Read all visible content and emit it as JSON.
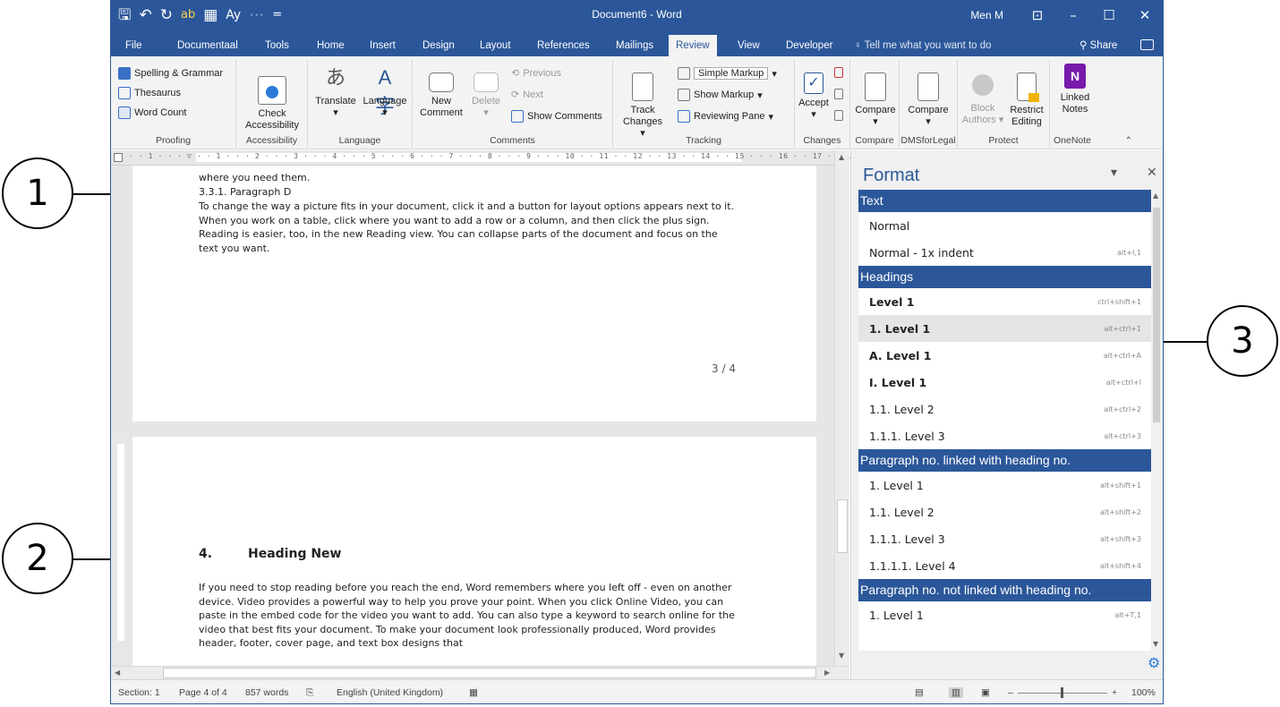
{
  "window": {
    "title": "Document6 - Word",
    "user": "Men M",
    "qat": [
      "🖫",
      "↶",
      "↻",
      "ab",
      "▦",
      "Ay",
      "⋯",
      "="
    ],
    "controls": [
      "⊡",
      "–",
      "☐",
      "✕"
    ]
  },
  "tabs": [
    "File",
    "Documentaal",
    "Tools",
    "Home",
    "Insert",
    "Design",
    "Layout",
    "References",
    "Mailings",
    "Review",
    "View",
    "Developer"
  ],
  "active_tab": "Review",
  "tell_me": "Tell me what you want to do",
  "share": "Share",
  "ribbon": {
    "proofing": {
      "spelling": "Spelling & Grammar",
      "thesaurus": "Thesaurus",
      "word_count": "Word Count",
      "label": "Proofing"
    },
    "accessibility": {
      "check1": "Check",
      "check2": "Accessibility",
      "label": "Accessibility"
    },
    "language": {
      "translate": "Translate",
      "language": "Language",
      "label": "Language"
    },
    "comments": {
      "new1": "New",
      "new2": "Comment",
      "delete": "Delete",
      "previous": "Previous",
      "next": "Next",
      "show": "Show Comments",
      "label": "Comments"
    },
    "tracking": {
      "track1": "Track",
      "track2": "Changes",
      "markup": "Simple Markup",
      "show_markup": "Show Markup",
      "reviewing": "Reviewing Pane",
      "label": "Tracking"
    },
    "changes": {
      "accept": "Accept",
      "label": "Changes"
    },
    "compare": {
      "btn": "Compare",
      "label": "Compare"
    },
    "dms": {
      "btn": "Compare",
      "label": "DMSforLegal"
    },
    "protect": {
      "block1": "Block",
      "block2": "Authors",
      "restrict1": "Restrict",
      "restrict2": "Editing",
      "label": "Protect"
    },
    "onenote": {
      "l1": "Linked",
      "l2": "Notes",
      "label": "OneNote"
    }
  },
  "ruler_text": "· · 1 · · · ▽ · · 1 · · · 2 · · · 3 · · · 4 · · · 5 · · · 6 · · · 7 · · · 8 · · · 9 · · · 10 · · 11 · · 12 · · 13 · · 14 · · 15 · · · 16 · · 17 · · 18 ·",
  "document": {
    "page1": {
      "line0": "where you need them.",
      "sub_heading": "3.3.1.   Paragraph D",
      "paragraph": "To change the way a picture fits in your document, click it and a button for layout options appears next to it. When you work on a table, click where you want to add a row or a column, and then click the plus sign. Reading is easier, too, in the new Reading view. You can collapse parts of the document and focus on the text you want.",
      "page_number": "3 / 4"
    },
    "page2": {
      "heading_num": "4.",
      "heading_text": "Heading New",
      "paragraph": "If you need to stop reading before you reach the end, Word remembers where you left off - even on another device. Video provides a powerful way to help you prove your point. When you click Online Video, you can paste in the embed code for the video you want to add. You can also type a keyword to search online for the video that best fits your document. To make your document look professionally produced, Word provides header, footer, cover page, and text box designs that"
    }
  },
  "format_pane": {
    "title": "Format",
    "sections": [
      {
        "title": "Text",
        "items": [
          {
            "label": "Normal",
            "shortcut": ""
          },
          {
            "label": "Normal - 1x indent",
            "shortcut": "alt+I,1"
          }
        ]
      },
      {
        "title": "Headings",
        "items": [
          {
            "label": "Level 1",
            "shortcut": "ctrl+shift+1",
            "bold": true
          },
          {
            "label": "1.  Level 1",
            "shortcut": "alt+ctrl+1",
            "bold": true,
            "selected": true
          },
          {
            "label": "A.  Level 1",
            "shortcut": "alt+ctrl+A",
            "bold": true
          },
          {
            "label": "I.  Level 1",
            "shortcut": "alt+ctrl+I",
            "bold": true
          },
          {
            "label": "1.1.  Level 2",
            "shortcut": "alt+ctrl+2"
          },
          {
            "label": "1.1.1.  Level 3",
            "shortcut": "alt+ctrl+3"
          }
        ]
      },
      {
        "title": "Paragraph no. linked with heading no.",
        "items": [
          {
            "label": "1.  Level 1",
            "shortcut": "alt+shift+1"
          },
          {
            "label": "1.1.  Level 2",
            "shortcut": "alt+shift+2"
          },
          {
            "label": "1.1.1.  Level 3",
            "shortcut": "alt+shift+3"
          },
          {
            "label": "1.1.1.1.  Level 4",
            "shortcut": "alt+shift+4"
          }
        ]
      },
      {
        "title": "Paragraph no. not linked with heading no.",
        "items": [
          {
            "label": "1.  Level 1",
            "shortcut": "alt+T,1"
          }
        ]
      }
    ]
  },
  "status": {
    "section": "Section: 1",
    "page": "Page 4 of 4",
    "words": "857 words",
    "language": "English (United Kingdom)",
    "zoom": "100%"
  },
  "callouts": [
    "1",
    "2",
    "3"
  ],
  "colors": {
    "accent": "#2b579a",
    "ribbon_bg": "#f3f3f3",
    "selected_row": "#e5e5e5"
  }
}
